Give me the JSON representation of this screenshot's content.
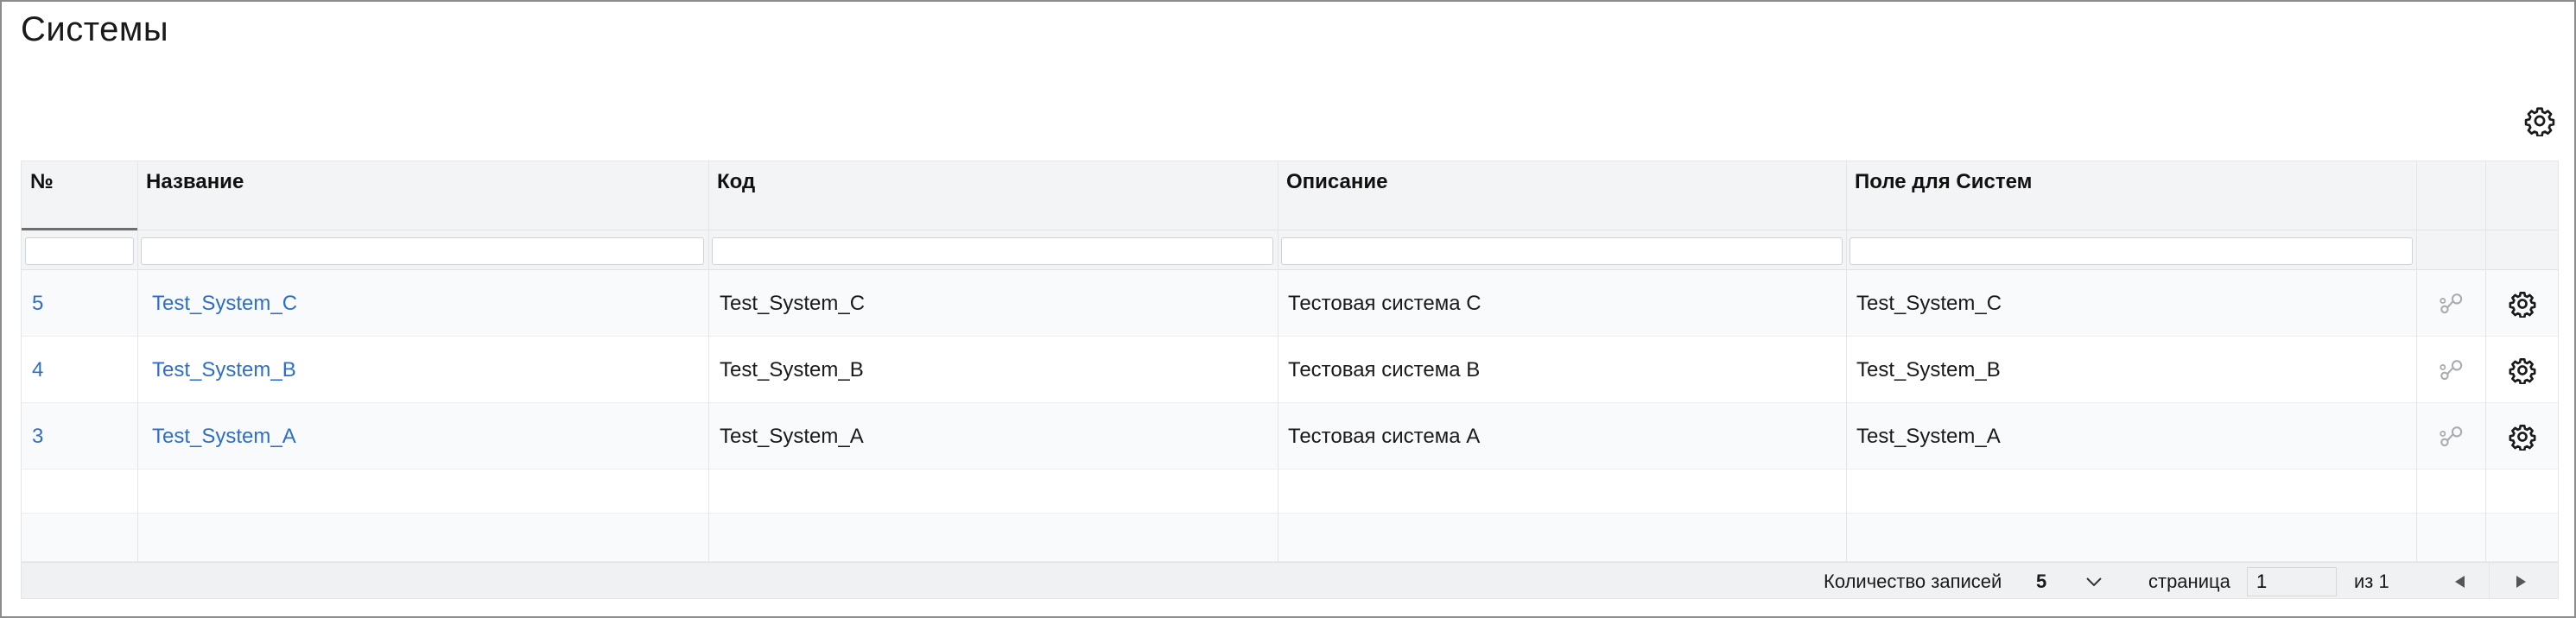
{
  "page": {
    "title": "Системы"
  },
  "table": {
    "columns": [
      {
        "key": "num",
        "label": "№"
      },
      {
        "key": "name",
        "label": "Название"
      },
      {
        "key": "code",
        "label": "Код"
      },
      {
        "key": "description",
        "label": "Описание"
      },
      {
        "key": "systems_field",
        "label": "Поле для Систем"
      }
    ],
    "filters": {
      "num": "",
      "name": "",
      "code": "",
      "description": "",
      "systems_field": ""
    },
    "rows": [
      {
        "num": "5",
        "name": "Test_System_C",
        "code": "Test_System_C",
        "description": "Тестовая система C",
        "systems_field": "Test_System_C"
      },
      {
        "num": "4",
        "name": "Test_System_B",
        "code": "Test_System_B",
        "description": "Тестовая система B",
        "systems_field": "Test_System_B"
      },
      {
        "num": "3",
        "name": "Test_System_A",
        "code": "Test_System_A",
        "description": "Тестовая система A",
        "systems_field": "Test_System_A"
      }
    ],
    "row_icons": {
      "link": "link-nodes-icon",
      "settings": "gear-icon"
    }
  },
  "footer": {
    "records_label": "Количество записей",
    "records_value": "5",
    "page_label": "страница",
    "page_value": "1",
    "of_label": "из 1",
    "prev_icon": "triangle-left-icon",
    "next_icon": "triangle-right-icon"
  },
  "colors": {
    "link": "#2f6ec7",
    "header_bg": "#f3f4f6",
    "border": "#e3e5e8",
    "footer_bg": "#eff1f3"
  }
}
